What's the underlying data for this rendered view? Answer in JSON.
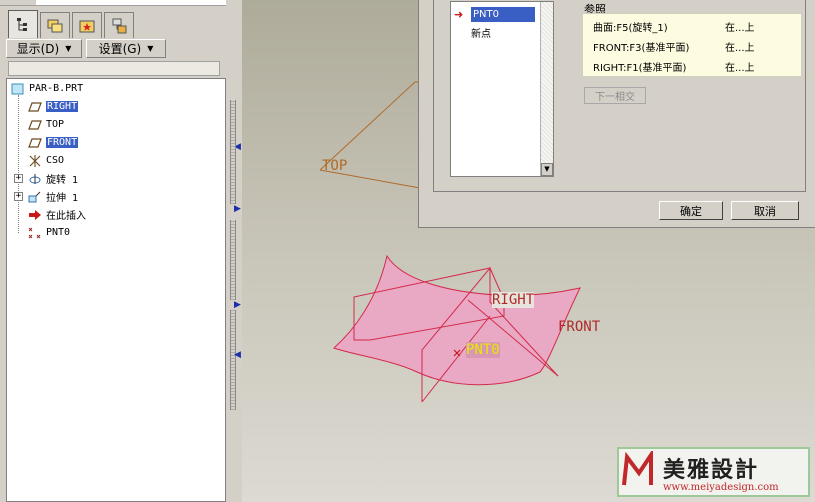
{
  "menu": {
    "display_label": "显示(D)",
    "settings_label": "设置(G)"
  },
  "tabs": [
    {
      "name": "model-tree-tab",
      "icon": "tree-icon"
    },
    {
      "name": "folder-browser-tab",
      "icon": "folders-icon"
    },
    {
      "name": "favorites-tab",
      "icon": "star-folder-icon"
    },
    {
      "name": "connections-tab",
      "icon": "network-icon"
    }
  ],
  "tree": {
    "root": "PAR-B.PRT",
    "items": [
      {
        "label": "RIGHT",
        "selected": true,
        "icon": "datum-plane-icon"
      },
      {
        "label": "TOP",
        "selected": false,
        "icon": "datum-plane-icon"
      },
      {
        "label": "FRONT",
        "selected": true,
        "icon": "datum-plane-icon"
      },
      {
        "label": "CSO",
        "selected": false,
        "icon": "csys-icon"
      },
      {
        "label": "旋转 1",
        "selected": false,
        "icon": "revolve-icon"
      },
      {
        "label": "拉伸 1",
        "selected": false,
        "icon": "extrude-icon"
      },
      {
        "label": "在此插入",
        "selected": false,
        "icon": "insert-here-icon"
      },
      {
        "label": "PNT0",
        "selected": false,
        "icon": "datum-point-icon"
      }
    ]
  },
  "graphics": {
    "labels": {
      "top": "TOP",
      "right": "RIGHT",
      "front": "FRONT",
      "point": "PNT0"
    },
    "colors": {
      "surface_fill": "#e9a8c4",
      "surface_edge": "#d42a4a",
      "datum_top": "#b06a2a",
      "label_right": "#b02a2a",
      "label_point": "#e8e800"
    }
  },
  "dialog": {
    "points": [
      {
        "label": "PNT0",
        "selected": true
      },
      {
        "label": "新点",
        "selected": false
      }
    ],
    "references_title": "参照",
    "references": [
      {
        "name": "曲面:F5(旋转_1)",
        "type": "在...上"
      },
      {
        "name": "FRONT:F3(基准平面)",
        "type": "在...上"
      },
      {
        "name": "RIGHT:F1(基准平面)",
        "type": "在...上"
      }
    ],
    "next_button": "下一相交",
    "ok_button": "确定",
    "cancel_button": "取消"
  },
  "watermark": {
    "brand": "美雅設計",
    "url": "www.meiyadesign.com"
  }
}
